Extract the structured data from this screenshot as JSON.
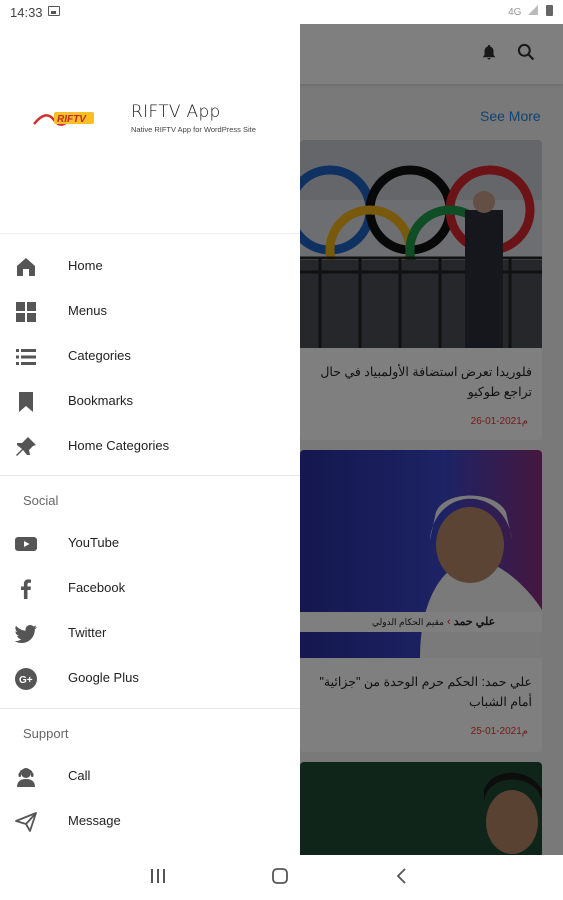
{
  "status_bar": {
    "time": "14:33",
    "network": "4G"
  },
  "drawer": {
    "app_name": "RIFTV App",
    "tagline": "Native RIFTV App for WordPress Site",
    "logo_text": "RIFTV",
    "main_items": [
      {
        "label": "Home",
        "icon": "home-icon"
      },
      {
        "label": "Menus",
        "icon": "grid-icon"
      },
      {
        "label": "Categories",
        "icon": "list-icon"
      },
      {
        "label": "Bookmarks",
        "icon": "bookmark-icon"
      },
      {
        "label": "Home Categories",
        "icon": "pin-icon"
      }
    ],
    "social_title": "Social",
    "social_items": [
      {
        "label": "YouTube",
        "icon": "youtube-icon"
      },
      {
        "label": "Facebook",
        "icon": "facebook-icon"
      },
      {
        "label": "Twitter",
        "icon": "twitter-icon"
      },
      {
        "label": "Google Plus",
        "icon": "google-plus-icon"
      }
    ],
    "support_title": "Support",
    "support_items": [
      {
        "label": "Call",
        "icon": "support-agent-icon"
      },
      {
        "label": "Message",
        "icon": "send-icon"
      }
    ]
  },
  "background": {
    "see_more": "See More",
    "articles": [
      {
        "title": "فلوريدا تعرض استضافة الأولمبياد في حال تراجع طوكيو",
        "date": "26-01-2021م"
      },
      {
        "title": "علي حمد: الحكم حرم الوحدة من \"جزائية\" أمام الشباب",
        "date": "25-01-2021م",
        "caption_name": "علي حمد",
        "caption_role": "مقيم الحكام الدولي"
      },
      {
        "title": "",
        "date": ""
      }
    ]
  },
  "colors": {
    "accent": "#1e88e5",
    "date": "#e53935",
    "icon": "#555555"
  }
}
